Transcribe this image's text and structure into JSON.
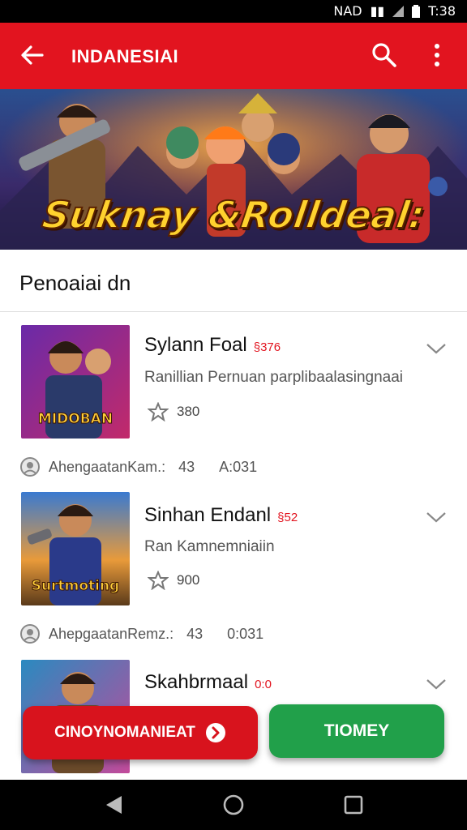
{
  "status_bar": {
    "network": "NAD",
    "battery": "▮▮",
    "time": "T:38"
  },
  "app_bar": {
    "title": "INDANESIAI"
  },
  "banner": {
    "title": "Suknay &Rolldeal:"
  },
  "section": {
    "title": "Penoaiai dn"
  },
  "games": [
    {
      "thumb_label": "MIDOBAN",
      "name": "Sylann Foal",
      "code": "§376",
      "description": "Ranillian Pernuan parplibaalasingnaai",
      "rating": "380",
      "meta_name": "AhengaatanKam.:",
      "meta_a": "43",
      "meta_b": "A:031"
    },
    {
      "thumb_label": "Surtmoting",
      "name": "Sinhan Endanl",
      "code": "§52",
      "description": "Ran Kamnemniaiin",
      "rating": "900",
      "meta_name": "AhepgaatanRemz.:",
      "meta_a": "43",
      "meta_b": "0:031"
    },
    {
      "thumb_label": "",
      "name": "Skahbrmaal",
      "code": "0:0",
      "description": "",
      "rating": "",
      "meta_name": "",
      "meta_a": "",
      "meta_b": ""
    }
  ],
  "buttons": {
    "primary": "CINOYNOMANIEAT",
    "secondary": "TIOMEY"
  },
  "colors": {
    "brand_red": "#e2141f",
    "button_red": "#d8131d",
    "button_green": "#21a04a",
    "banner_title": "#ffd22e"
  }
}
